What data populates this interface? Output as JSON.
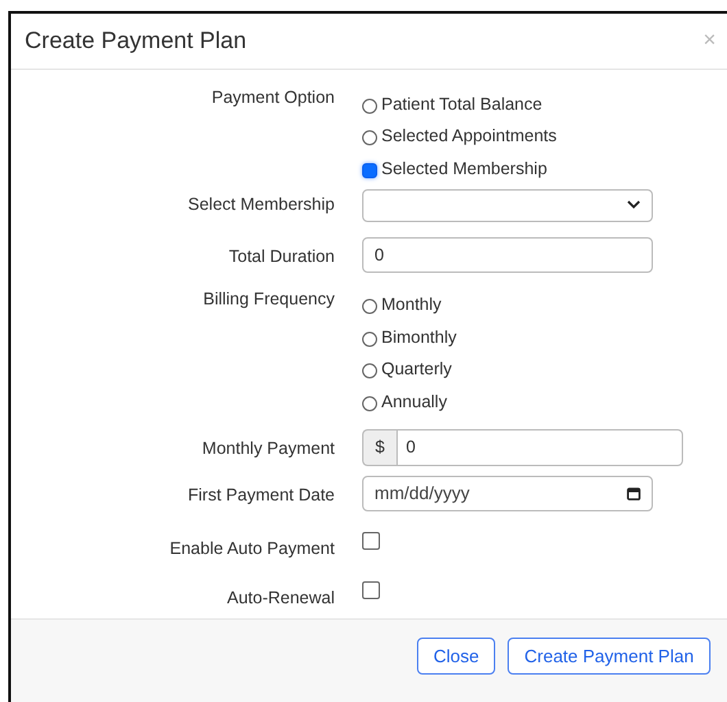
{
  "dialog": {
    "title": "Create Payment Plan",
    "close": "×"
  },
  "fields": [
    {
      "kind": "radio",
      "label": "Payment Option",
      "options": [
        {
          "label": "Patient Total Balance",
          "selected": false
        },
        {
          "label": "Selected Appointments",
          "selected": false
        },
        {
          "label": "Selected Membership",
          "selected": true
        }
      ]
    },
    {
      "kind": "select",
      "label": "Select Membership"
    },
    {
      "kind": "text",
      "label": "Total Duration",
      "value": "0"
    },
    {
      "kind": "radio",
      "label": "Billing Frequency",
      "options": [
        {
          "label": "Monthly",
          "selected": false
        },
        {
          "label": "Bimonthly",
          "selected": false
        },
        {
          "label": "Quarterly",
          "selected": false
        },
        {
          "label": "Annually",
          "selected": false
        }
      ]
    },
    {
      "kind": "money",
      "label": "Monthly Payment",
      "prefix": "$",
      "value": "0"
    },
    {
      "kind": "date",
      "label": "First Payment Date",
      "placeholder": "mm/dd/yyyy"
    },
    {
      "kind": "checkbox",
      "label": "Enable Auto Payment",
      "checked": false
    },
    {
      "kind": "checkbox",
      "label": "Auto-Renewal",
      "checked": false
    }
  ],
  "buttons": [
    "Close",
    "Create Payment Plan"
  ]
}
